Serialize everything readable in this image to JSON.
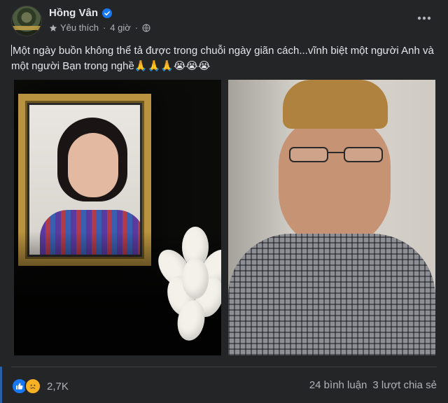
{
  "post": {
    "author": "Hồng Vân",
    "meta_label": "Yêu thích",
    "time": "4 giờ",
    "text": "Một ngày buồn không thể tả được trong chuỗi ngày giãn cách...vĩnh biệt một người Anh và một người Bạn trong nghề🙏🙏🙏😭😭😭",
    "photos": [
      {
        "subject": "portrait-woman-framed"
      },
      {
        "subject": "portrait-man-hat"
      }
    ]
  },
  "footer": {
    "reaction_count": "2,7K",
    "comments": "24 bình luận",
    "shares": "3 lượt chia sẻ"
  },
  "icons": {
    "verified": "verified-badge-icon",
    "favorite": "star-icon",
    "audience": "globe-icon",
    "more": "more-options-icon",
    "like": "like-reaction-icon",
    "sad": "sad-reaction-icon"
  },
  "colors": {
    "card_bg": "#242526",
    "page_bg": "#18191a",
    "text_primary": "#e4e6eb",
    "text_secondary": "#b0b3b8",
    "accent": "#1877f2",
    "sad": "#f7b125"
  }
}
